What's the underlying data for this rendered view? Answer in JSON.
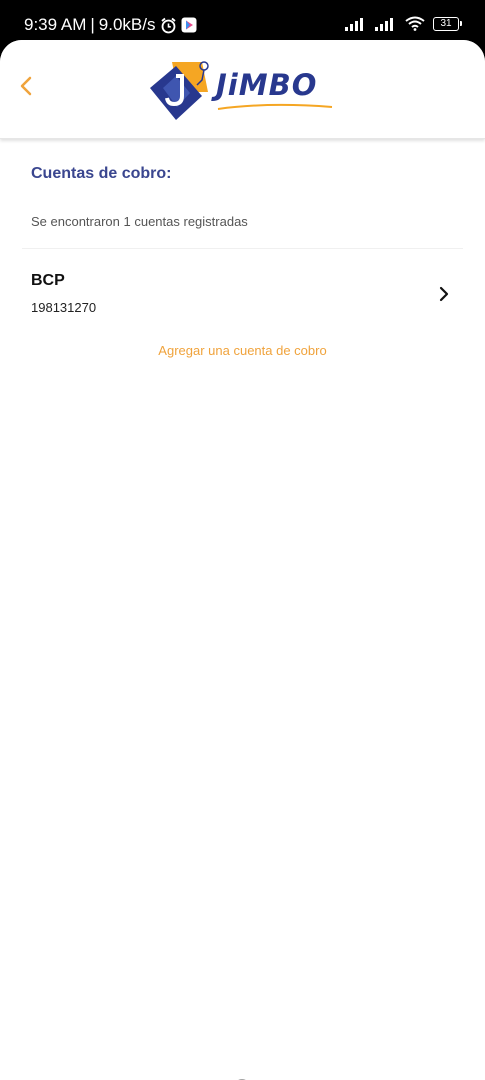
{
  "status_bar": {
    "time": "9:39 AM",
    "separator": "|",
    "network_speed": "9.0kB/s",
    "battery_level": "31",
    "icons": [
      "alarm-icon",
      "play-store-icon",
      "signal-icon",
      "signal-icon",
      "wifi-icon",
      "battery-icon"
    ]
  },
  "header": {
    "back_icon": "chevron-left-icon",
    "logo_text": "JiMBO",
    "colors": {
      "accent": "#f0a33c",
      "brand_blue": "#28388e"
    }
  },
  "main": {
    "section_title": "Cuentas de cobro:",
    "results_text": "Se encontraron 1 cuentas registradas",
    "accounts": [
      {
        "name": "BCP",
        "number": "198131270"
      }
    ],
    "add_account_label": "Agregar una cuenta de cobro"
  },
  "navigation_bar": {
    "icons": [
      "recents-icon",
      "home-icon",
      "back-icon"
    ]
  }
}
